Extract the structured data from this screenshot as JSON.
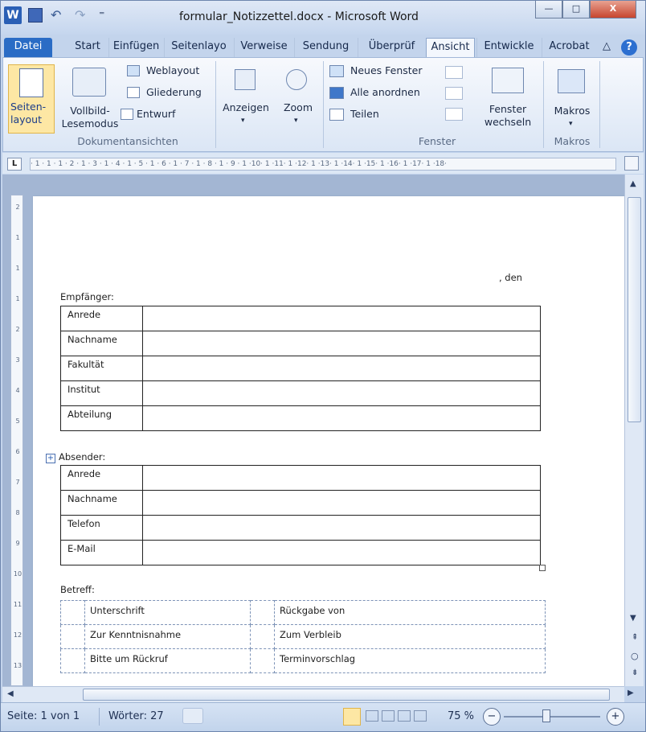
{
  "window": {
    "title": "formular_Notizzettel.docx - Microsoft Word",
    "min_glyph": "—",
    "max_glyph": "□",
    "close_glyph": "X"
  },
  "quick_access": {
    "undo_glyph": "↶",
    "redo_glyph": "↷",
    "customize_glyph": "⁼"
  },
  "tabs": [
    {
      "label": "Datei"
    },
    {
      "label": "Start"
    },
    {
      "label": "Einfügen"
    },
    {
      "label": "Seitenlayo"
    },
    {
      "label": "Verweise"
    },
    {
      "label": "Sendung"
    },
    {
      "label": "Überprüf"
    },
    {
      "label": "Ansicht"
    },
    {
      "label": "Entwickle"
    },
    {
      "label": "Acrobat"
    }
  ],
  "ribbon": {
    "seitenlayout": "Seiten-\nlayout",
    "vollbild": "Vollbild-\nLesemodus",
    "weblayout": "Weblayout",
    "gliederung": "Gliederung",
    "entwurf": "Entwurf",
    "anzeigen": "Anzeigen",
    "zoom": "Zoom",
    "neues_fenster": "Neues Fenster",
    "alle_anordnen": "Alle anordnen",
    "teilen": "Teilen",
    "fenster_wechseln": "Fenster\nwechseln",
    "makros": "Makros",
    "group_dokumentansichten": "Dokumentansichten",
    "group_fenster": "Fenster",
    "group_makros": "Makros",
    "dropdown_glyph": "▾",
    "collapse_glyph": "△",
    "help_glyph": "?"
  },
  "ruler": {
    "tab_selector": "L",
    "labels": "· 1 · 1 · 1 · 2 · 1 · 3 · 1 · 4 · 1 · 5 · 1 · 6 · 1 · 7 · 1 · 8 · 1 · 9 · 1 ·10· 1 ·11· 1 ·12· 1 ·13· 1 ·14· 1 ·15· 1 ·16· 1 ·17· 1 ·18·",
    "vlabels": [
      "2",
      "1",
      "1",
      "1",
      "2",
      "3",
      "4",
      "5",
      "6",
      "7",
      "8",
      "9",
      "10",
      "11",
      "12",
      "13"
    ]
  },
  "document": {
    "date_line": ", den",
    "recipient_label": "Empfänger:",
    "recipient_rows": [
      "Anrede",
      "Nachname",
      "Fakultät",
      "Institut",
      "Abteilung"
    ],
    "sender_label": "Absender:",
    "sender_rows": [
      "Anrede",
      "Nachname",
      "Telefon",
      "E-Mail"
    ],
    "subject_label": "Betreff:",
    "checklist": [
      [
        "Unterschrift",
        "Rückgabe von"
      ],
      [
        "Zur Kenntnisnahme",
        "Zum Verbleib"
      ],
      [
        "Bitte um Rückruf",
        "Terminvorschlag"
      ]
    ]
  },
  "statusbar": {
    "page": "Seite: 1 von 1",
    "words": "Wörter: 27",
    "zoom": "75 %",
    "zoom_out": "−",
    "zoom_in": "+"
  },
  "colors": {
    "file_tab": "#2a6cc5",
    "close_button": "#c7452f",
    "ribbon_bg": "#dbe6f5"
  }
}
